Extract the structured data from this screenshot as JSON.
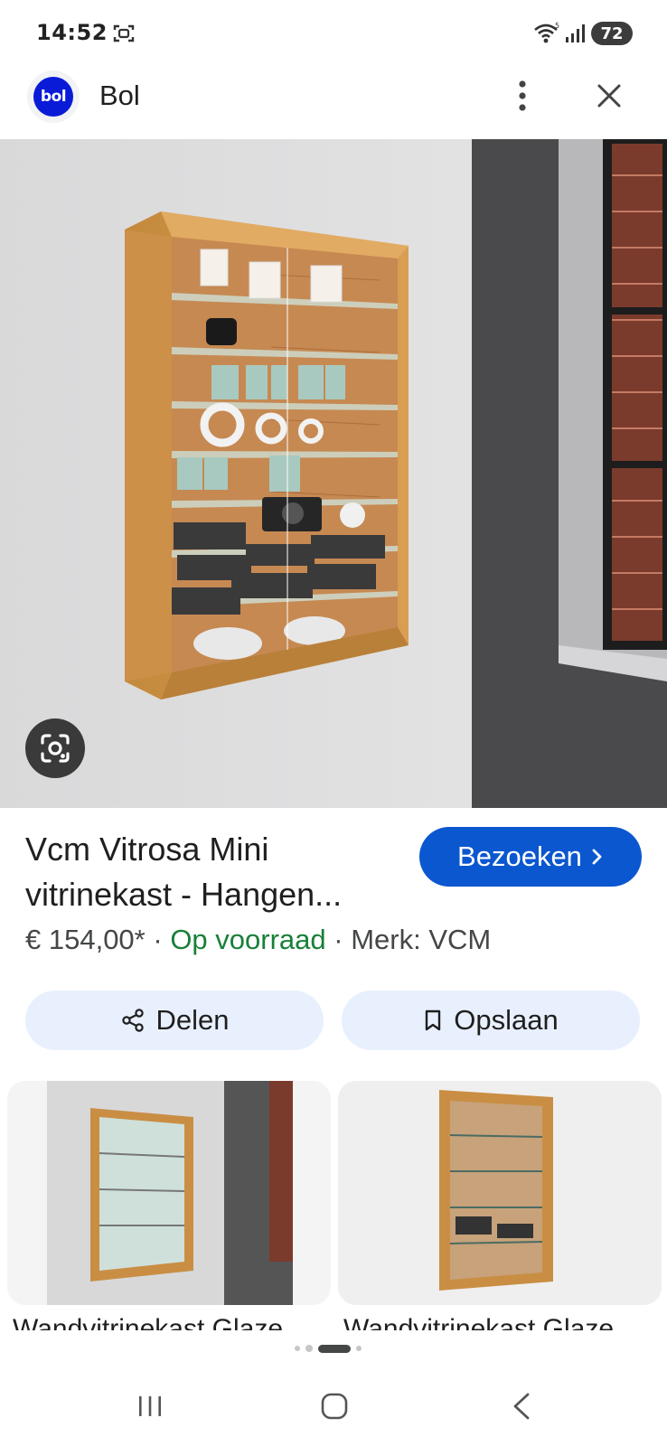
{
  "status_bar": {
    "time": "14:52",
    "battery": "72",
    "icons": [
      "screenshot-icon",
      "wifi-icon",
      "signal-icon"
    ]
  },
  "header": {
    "logo_text": "bol",
    "site_name": "Bol",
    "icons": [
      "more-vert-icon",
      "close-icon"
    ]
  },
  "hero": {
    "icon": "google-lens-icon"
  },
  "product": {
    "title": "Vcm Vitrosa Mini vitrinekast - Hangen...",
    "visit_label": "Bezoeken",
    "visit_icon": "chevron-right-icon",
    "price": "€ 154,00*",
    "sep1": "·",
    "stock": "Op voorraad",
    "sep2": "·",
    "brand": "Merk: VCM"
  },
  "actions": {
    "share_label": "Delen",
    "save_label": "Opslaan"
  },
  "related": [
    {
      "title": "Wandvitrinekast Glaze"
    },
    {
      "title": "Wandvitrinekast Glaze"
    }
  ],
  "pagination": {
    "active_index": 2,
    "count": 4
  },
  "colors": {
    "accent": "#0b57d0",
    "stock_green": "#188038",
    "button_bg": "#e8f0fe",
    "brand_blue": "#0a1bd8"
  }
}
